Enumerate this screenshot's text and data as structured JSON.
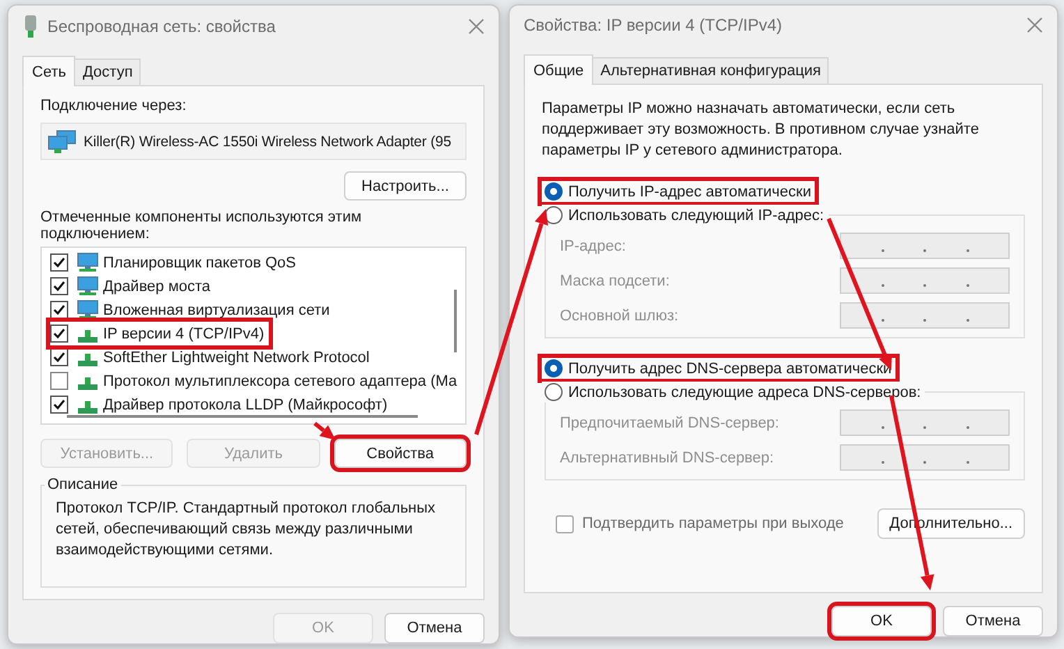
{
  "left_window": {
    "title": "Беспроводная сеть: свойства",
    "tabs": [
      {
        "label": "Сеть",
        "selected": true
      },
      {
        "label": "Доступ",
        "selected": false
      }
    ],
    "connect_via_label": "Подключение через:",
    "adapter": "Killer(R) Wireless-AC 1550i Wireless Network Adapter (95",
    "configure_button": "Настроить...",
    "components_label": "Отмеченные компоненты используются этим подключением:",
    "components": [
      {
        "kind": "service",
        "label": "Планировщик пакетов QoS",
        "checked": true,
        "highlighted": false
      },
      {
        "kind": "service",
        "label": "Драйвер моста",
        "checked": true,
        "highlighted": false
      },
      {
        "kind": "service",
        "label": "Вложенная виртуализация сети",
        "checked": true,
        "highlighted": false
      },
      {
        "kind": "protocol",
        "label": "IP версии 4 (TCP/IPv4)",
        "checked": true,
        "highlighted": true
      },
      {
        "kind": "protocol",
        "label": "SoftEther Lightweight Network Protocol",
        "checked": true,
        "highlighted": false
      },
      {
        "kind": "protocol",
        "label": "Протокол мультиплексора сетевого адаптера (Ма",
        "checked": false,
        "highlighted": false
      },
      {
        "kind": "protocol",
        "label": "Драйвер протокола LLDP (Майкрософт)",
        "checked": true,
        "highlighted": false
      }
    ],
    "buttons": [
      {
        "label": "Установить...",
        "disabled": true,
        "highlighted": false
      },
      {
        "label": "Удалить",
        "disabled": true,
        "highlighted": false
      },
      {
        "label": "Свойства",
        "disabled": false,
        "highlighted": true
      }
    ],
    "description": {
      "title": "Описание",
      "text": "Протокол TCP/IP. Стандартный протокол глобальных сетей, обеспечивающий связь между различными взаимодействующими сетями."
    },
    "footer_buttons": [
      {
        "label": "OK",
        "disabled": true,
        "highlighted": false
      },
      {
        "label": "Отмена",
        "disabled": false,
        "highlighted": false
      }
    ]
  },
  "right_window": {
    "title": "Свойства: IP версии 4 (TCP/IPv4)",
    "tabs": [
      {
        "label": "Общие",
        "selected": true
      },
      {
        "label": "Альтернативная конфигурация",
        "selected": false
      }
    ],
    "intro": "Параметры IP можно назначать автоматически, если сеть поддерживает эту возможность. В противном случае узнайте параметры IP у сетевого администратора.",
    "ip_options": [
      {
        "label": "Получить IP-адрес автоматически",
        "selected": true,
        "highlighted": true
      },
      {
        "label": "Использовать следующий IP-адрес:",
        "selected": false,
        "highlighted": false
      }
    ],
    "ip_fields": [
      {
        "label": "IP-адрес:",
        "disabled": true
      },
      {
        "label": "Маска подсети:",
        "disabled": true
      },
      {
        "label": "Основной шлюз:",
        "disabled": true
      }
    ],
    "dns_options": [
      {
        "label": "Получить адрес DNS-сервера автоматически",
        "selected": true,
        "highlighted": true
      },
      {
        "label": "Использовать следующие адреса DNS-серверов:",
        "selected": false,
        "highlighted": false
      }
    ],
    "dns_fields": [
      {
        "label": "Предпочитаемый DNS-сервер:",
        "disabled": true
      },
      {
        "label": "Альтернативный DNS-сервер:",
        "disabled": true
      }
    ],
    "validate_checkbox": {
      "label": "Подтвердить параметры при выходе",
      "checked": false
    },
    "advanced_button": "Дополнительно...",
    "footer_buttons": [
      {
        "label": "OK",
        "disabled": false,
        "highlighted": true
      },
      {
        "label": "Отмена",
        "disabled": false,
        "highlighted": false
      }
    ]
  }
}
